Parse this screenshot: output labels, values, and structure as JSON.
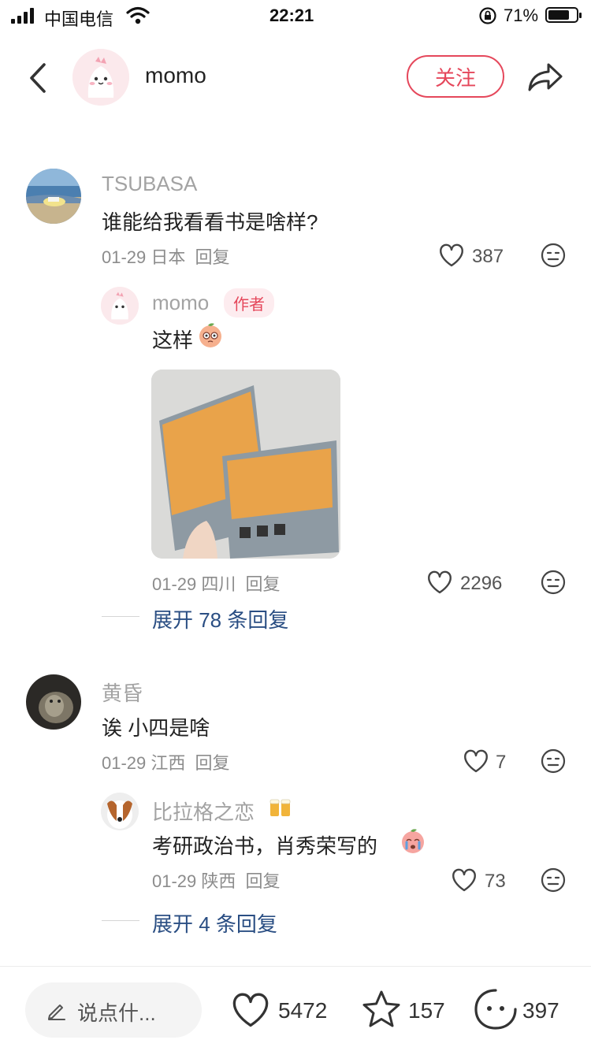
{
  "status_bar": {
    "carrier": "中国电信",
    "time": "22:21",
    "battery_percent": "71%"
  },
  "header": {
    "username": "momo",
    "follow_label": "关注"
  },
  "comments": [
    {
      "username": "TSUBASA",
      "text": "谁能给我看看书是啥样?",
      "date": "01-29",
      "location": "日本",
      "reply_label": "回复",
      "likes": "387",
      "reply": {
        "username": "momo",
        "author_tag": "作者",
        "text": "这样",
        "date": "01-29",
        "location": "四川",
        "reply_label": "回复",
        "likes": "2296"
      },
      "expand_label": "展开 78 条回复"
    },
    {
      "username": "黄昏",
      "text": "诶 小四是啥",
      "date": "01-29",
      "location": "江西",
      "reply_label": "回复",
      "likes": "7",
      "reply": {
        "username": "比拉格之恋",
        "text": "考研政治书，肖秀荣写的",
        "date": "01-29",
        "location": "陕西",
        "reply_label": "回复",
        "likes": "73"
      },
      "expand_label": "展开 4 条回复"
    }
  ],
  "bottom_bar": {
    "input_placeholder": "说点什...",
    "likes": "5472",
    "favorites": "157",
    "comments": "397"
  },
  "colors": {
    "accent": "#e5475b",
    "link": "#2a4e83",
    "muted": "#a3a3a3"
  }
}
